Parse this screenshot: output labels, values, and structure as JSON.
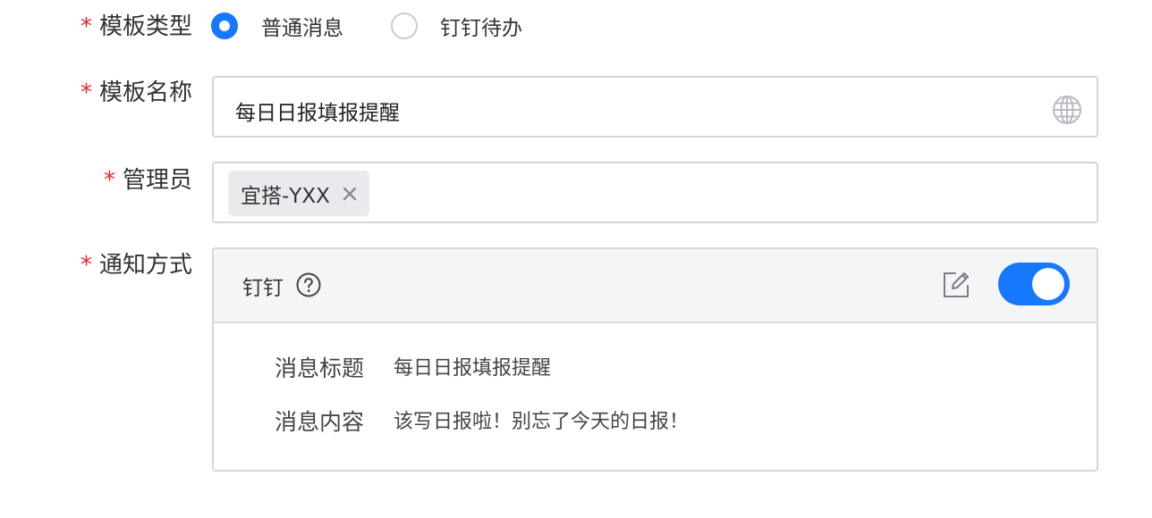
{
  "form": {
    "required_mark": "*",
    "template_type": {
      "label": "模板类型",
      "options": [
        {
          "label": "普通消息",
          "checked": true
        },
        {
          "label": "钉钉待办",
          "checked": false
        }
      ]
    },
    "template_name": {
      "label": "模板名称",
      "value": "每日日报填报提醒",
      "icon": "globe-icon"
    },
    "admin": {
      "label": "管理员",
      "tags": [
        "宜搭-YXX"
      ]
    },
    "notify_method": {
      "label": "通知方式",
      "channel": "钉钉",
      "help_icon": "question-circle-icon",
      "edit_icon": "edit-icon",
      "enabled": true,
      "message_title_label": "消息标题",
      "message_title": "每日日报填报提醒",
      "message_content_label": "消息内容",
      "message_content": "该写日报啦！别忘了今天的日报！"
    }
  },
  "colors": {
    "accent": "#1677ff",
    "required": "#e8262a",
    "border": "#d4d6da",
    "panel_header_bg": "#f4f5f7"
  }
}
